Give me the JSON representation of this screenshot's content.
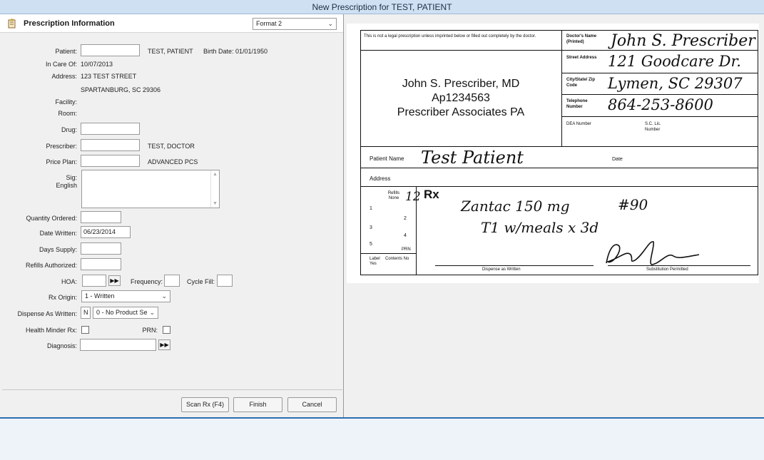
{
  "window": {
    "title": "New Prescription for TEST, PATIENT"
  },
  "colors": {
    "titlebar": "#cfe0f3",
    "accent_line": "#2c6fae",
    "pane_bg": "#f0f0f0"
  },
  "header": {
    "icon": "prescription-icon",
    "title": "Prescription Information",
    "format_select": "Format 2"
  },
  "form": {
    "patient_label": "Patient:",
    "patient_value": "",
    "patient_name": "TEST, PATIENT",
    "birth_date": "Birth Date: 01/01/1950",
    "in_care_of_label": "In Care Of:",
    "in_care_of_value": "10/07/2013",
    "address_label": "Address:",
    "address_line1": "123 TEST STREET",
    "address_line2": "SPARTANBURG, SC 29306",
    "facility_label": "Facility:",
    "room_label": "Room:",
    "drug_label": "Drug:",
    "drug_value": "",
    "prescriber_label": "Prescriber:",
    "prescriber_value": "",
    "prescriber_name": "TEST, DOCTOR",
    "price_plan_label": "Price Plan:",
    "price_plan_value": "",
    "price_plan_name": "ADVANCED PCS",
    "sig_label": "Sig:",
    "sig_language": "English",
    "sig_value": "",
    "quantity_label": "Quantity Ordered:",
    "quantity_value": "",
    "date_written_label": "Date Written:",
    "date_written_value": "06/23/2014",
    "days_supply_label": "Days Supply:",
    "days_supply_value": "",
    "refills_label": "Refills Authorized:",
    "refills_value": "",
    "hoa_label": "HOA:",
    "hoa_value": "",
    "hoa_arrow": "▶▶",
    "frequency_label": "Frequency:",
    "frequency_value": "",
    "cycle_fill_label": "Cycle Fill:",
    "cycle_fill_value": "",
    "rx_origin_label": "Rx Origin:",
    "rx_origin_value": "1 - Written",
    "daw_label": "Dispense As Written:",
    "daw_code": "N",
    "daw_value": "0 - No Product Se",
    "health_minder_label": "Health Minder Rx:",
    "health_minder_checked": false,
    "prn_label": "PRN:",
    "prn_checked": false,
    "diagnosis_label": "Diagnosis:",
    "diagnosis_value": "",
    "diagnosis_arrow": "▶▶"
  },
  "buttons": {
    "scan": "Scan Rx (F4)",
    "finish": "Finish",
    "cancel": "Cancel"
  },
  "rx_image": {
    "disclaimer": "This is not a legal prescription unless imprinted below or filled out completely by the doctor.",
    "doctors_name_label": "Doctor's Name (Printed)",
    "doctors_name": "John S. Prescriber",
    "street_label": "Street Address",
    "street": "121 Goodcare Dr.",
    "city_label": "City/State/ Zip Code",
    "city": "Lymen, SC 29307",
    "telephone_label": "Telephone Number",
    "telephone": "864-253-8600",
    "dea_label": "DEA Number",
    "sc_lic_label": "S.C. Lic. Number",
    "imprint_line1": "John S. Prescriber, MD",
    "imprint_line2": "Ap1234563",
    "imprint_line3": "Prescriber Associates PA",
    "patient_name_label": "Patient Name",
    "patient_name": "Test Patient",
    "date_label": "Date",
    "address_label": "Address",
    "refills_label": "Refills None",
    "refills_handwritten": "12",
    "refill_numbers": [
      "1",
      "2",
      "3",
      "4",
      "5",
      "PRN"
    ],
    "rx_symbol": "Rx",
    "rx_line1": "Zantac 150 mg",
    "rx_qty": "#90",
    "rx_line2": "T1 w/meals x 3d",
    "label_label": "Label Yes",
    "contents_label": "Contents No",
    "dispense_label": "Dispense as Written",
    "substitution_label": "Substitution Permitted"
  }
}
